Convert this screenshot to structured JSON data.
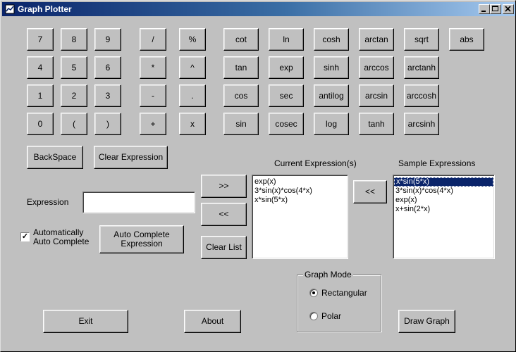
{
  "window": {
    "title": "Graph Plotter"
  },
  "keypad": {
    "row1": [
      "7",
      "8",
      "9",
      "/",
      "%"
    ],
    "row2": [
      "4",
      "5",
      "6",
      "*",
      "^"
    ],
    "row3": [
      "1",
      "2",
      "3",
      "-",
      "."
    ],
    "row4": [
      "0",
      "(",
      ")",
      "+",
      "x"
    ]
  },
  "functions": {
    "col1": [
      "cot",
      "tan",
      "cos",
      "sin"
    ],
    "col2": [
      "ln",
      "exp",
      "sec",
      "cosec"
    ],
    "col3": [
      "cosh",
      "sinh",
      "antilog",
      "log"
    ],
    "col4": [
      "arctan",
      "arccos",
      "arcsin",
      "tanh"
    ],
    "col5": [
      "sqrt",
      "arctanh",
      "arccosh",
      "arcsinh"
    ],
    "col6": [
      "abs"
    ]
  },
  "buttons": {
    "backspace": "BackSpace",
    "clear_expression": "Clear Expression",
    "add": ">>",
    "remove": "<<",
    "clear_list": "Clear List",
    "copy_sample": "<<",
    "auto_complete_line1": "Auto Complete",
    "auto_complete_line2": "Expression",
    "exit": "Exit",
    "about": "About",
    "draw_graph": "Draw Graph"
  },
  "expression": {
    "label": "Expression",
    "value": ""
  },
  "auto_complete_check": {
    "line1": "Automatically",
    "line2": "Auto Complete",
    "checked": true
  },
  "current_expressions": {
    "label": "Current Expression(s)",
    "items": [
      "exp(x)",
      "3*sin(x)*cos(4*x)",
      "x*sin(5*x)"
    ]
  },
  "sample_expressions": {
    "label": "Sample Expressions",
    "items": [
      "x*sin(5*x)",
      "3*sin(x)*cos(4*x)",
      "exp(x)",
      "x+sin(2*x)"
    ],
    "selected_index": 0
  },
  "graph_mode": {
    "label": "Graph Mode",
    "options": [
      "Rectangular",
      "Polar"
    ],
    "selected": "Rectangular"
  }
}
